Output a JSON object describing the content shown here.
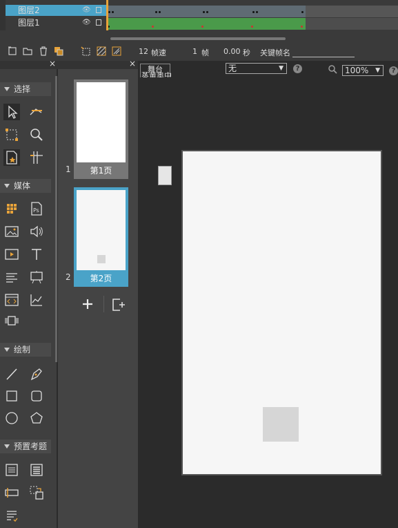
{
  "timeline": {
    "layers": [
      {
        "name": "图层2",
        "selected": true
      },
      {
        "name": "图层1",
        "selected": false
      }
    ]
  },
  "timeline_toolbar": {
    "fps_value": "12",
    "fps_label": "帧速",
    "frame_value": "1",
    "frame_label": "帧",
    "time_value": "0.00",
    "time_label": "秒",
    "keyframe_name_label": "关键帧名"
  },
  "tool_sections": {
    "select": "选择",
    "media": "媒体",
    "draw": "绘制",
    "preset": "预置考题"
  },
  "pages": {
    "items": [
      {
        "number": "1",
        "label": "第1页"
      },
      {
        "number": "2",
        "label": "第2页"
      }
    ]
  },
  "stage": {
    "tab_label": "舞台",
    "tab_sub_label": "蒸黄奥中",
    "transition_value": "无",
    "zoom_value": "100%"
  },
  "colors": {
    "accent_blue": "#4aa3c8",
    "track_green": "#4a9a4a",
    "playhead_orange": "#e8a33a",
    "keyframe_red": "#d03030"
  }
}
